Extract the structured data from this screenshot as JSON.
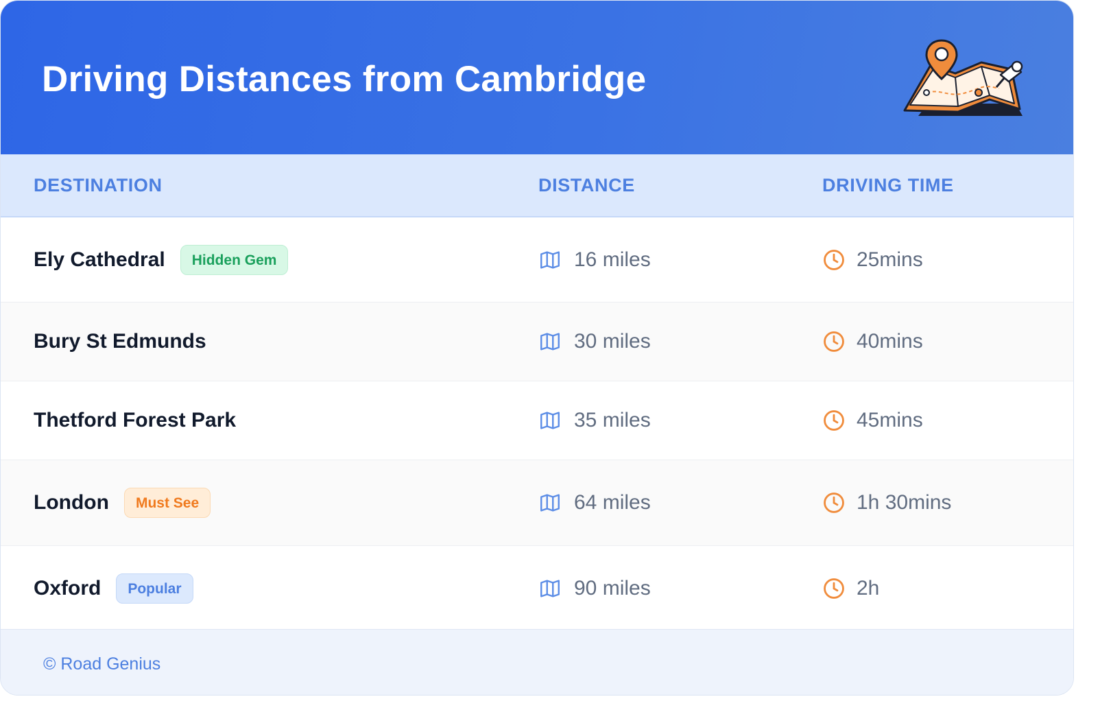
{
  "header": {
    "title": "Driving Distances from Cambridge"
  },
  "table": {
    "columns": {
      "destination": "DESTINATION",
      "distance": "DISTANCE",
      "driving_time": "DRIVING TIME"
    },
    "rows": [
      {
        "destination": "Ely Cathedral",
        "badge": "Hidden Gem",
        "badge_color": "#1aa05c",
        "distance": "16 miles",
        "time": "25mins"
      },
      {
        "destination": "Bury St Edmunds",
        "badge": "",
        "distance": "30 miles",
        "time": "40mins"
      },
      {
        "destination": "Thetford Forest Park",
        "badge": "",
        "distance": "35 miles",
        "time": "45mins"
      },
      {
        "destination": "London",
        "badge": "Must See",
        "badge_color": "#f07a1e",
        "distance": "64 miles",
        "time": "1h 30mins"
      },
      {
        "destination": "Oxford",
        "badge": "Popular",
        "badge_color": "#4c7fe0",
        "distance": "90 miles",
        "time": "2h"
      }
    ]
  },
  "icons": {
    "distance": "map-icon",
    "time": "clock-icon",
    "header": "map-pin-illustration"
  },
  "colors": {
    "header_bg": "#2e66e6",
    "accent": "#4c7fe0",
    "clock": "#f08c3c"
  },
  "footer": {
    "copyright": "© Road Genius"
  }
}
